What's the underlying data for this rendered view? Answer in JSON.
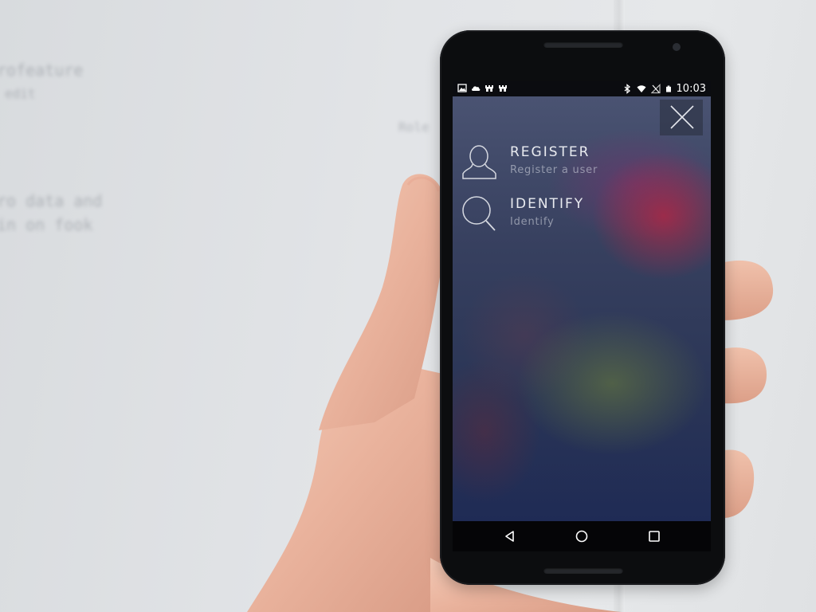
{
  "status_bar": {
    "time": "10:03",
    "left_icons": [
      "image-icon",
      "cloud-icon",
      "castle-icon",
      "castle-icon"
    ],
    "right_icons": [
      "bluetooth-icon",
      "wifi-icon",
      "no-signal-icon",
      "battery-icon"
    ]
  },
  "menu": {
    "items": [
      {
        "title": "REGISTER",
        "subtitle": "Register a user",
        "icon": "user-icon"
      },
      {
        "title": "IDENTIFY",
        "subtitle": "Identify",
        "icon": "search-icon"
      }
    ]
  },
  "close": {
    "icon": "close-icon"
  },
  "nav_bar": {
    "buttons": [
      "back-icon",
      "home-icon",
      "recents-icon"
    ]
  },
  "colors": {
    "text_primary": "#e9ebf0",
    "text_secondary": "#c8ccd6",
    "status_bar_bg": "#0b0c10",
    "nav_bar_bg": "#050507",
    "phone_body": "#0c0d0f"
  }
}
